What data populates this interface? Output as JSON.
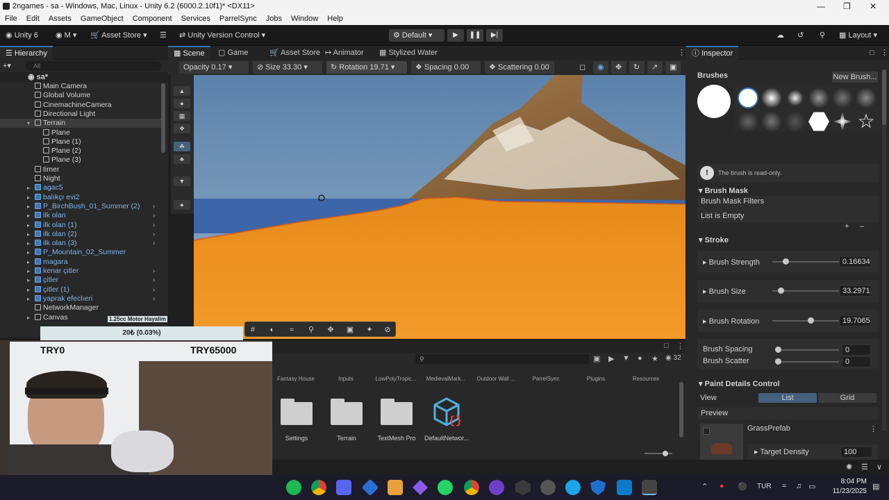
{
  "window": {
    "title": "2ngames - sa - Windows, Mac, Linux - Unity 6.2 (6000.2.10f1)* <DX11>"
  },
  "menu": [
    "File",
    "Edit",
    "Assets",
    "GameObject",
    "Component",
    "Services",
    "ParrelSync",
    "Jobs",
    "Window",
    "Help"
  ],
  "toolbar": {
    "account": "Unity 6",
    "m_label": "M",
    "asset_store": "Asset Store",
    "version_control": "Unity Version Control",
    "layout_default": "Default",
    "layout": "Layout"
  },
  "hierarchy": {
    "title": "Hierarchy",
    "search_placeholder": "All",
    "scene": "sa*",
    "items": [
      {
        "name": "Main Camera",
        "prefab": false,
        "indent": 1
      },
      {
        "name": "Global Volume",
        "prefab": false,
        "indent": 1
      },
      {
        "name": "CinemachineCamera",
        "prefab": false,
        "indent": 1
      },
      {
        "name": "Directional Light",
        "prefab": false,
        "indent": 1
      },
      {
        "name": "Terrain",
        "prefab": false,
        "indent": 1
      },
      {
        "name": "Plane",
        "prefab": false,
        "indent": 2
      },
      {
        "name": "Plane (1)",
        "prefab": false,
        "indent": 2
      },
      {
        "name": "Plane (2)",
        "prefab": false,
        "indent": 2
      },
      {
        "name": "Plane (3)",
        "prefab": false,
        "indent": 2
      },
      {
        "name": "timer",
        "prefab": false,
        "indent": 1
      },
      {
        "name": "Night",
        "prefab": false,
        "indent": 1
      },
      {
        "name": "agac5",
        "prefab": true,
        "indent": 1
      },
      {
        "name": "balıkçı evi2",
        "prefab": true,
        "indent": 1
      },
      {
        "name": "P_BirchBush_01_Summer (2)",
        "prefab": true,
        "indent": 1
      },
      {
        "name": "ilk olan",
        "prefab": true,
        "indent": 1
      },
      {
        "name": "ilk olan (1)",
        "prefab": true,
        "indent": 1
      },
      {
        "name": "ilk olan (2)",
        "prefab": true,
        "indent": 1
      },
      {
        "name": "ilk olan (3)",
        "prefab": true,
        "indent": 1
      },
      {
        "name": "P_Mountain_02_Summer",
        "prefab": true,
        "indent": 1
      },
      {
        "name": "magara",
        "prefab": true,
        "indent": 1
      },
      {
        "name": "kenar çitler",
        "prefab": true,
        "indent": 1
      },
      {
        "name": "çitler",
        "prefab": true,
        "indent": 1
      },
      {
        "name": "çitler (1)",
        "prefab": true,
        "indent": 1
      },
      {
        "name": "yaprak efeclıeri",
        "prefab": true,
        "indent": 1
      },
      {
        "name": "NetworkManager",
        "prefab": false,
        "indent": 1
      },
      {
        "name": "Canvas",
        "prefab": false,
        "indent": 1
      }
    ]
  },
  "scene_tabs": [
    "Scene",
    "Game",
    "Asset Store",
    "Animator",
    "Stylized Water"
  ],
  "scene_toolbar": {
    "opacity": "Opacity 0.17",
    "size": "Size 33.30",
    "rotation": "Rotation 19.71",
    "spacing": "Spacing 0.00",
    "scattering": "Scattering 0.00"
  },
  "project": {
    "count": "32",
    "top_folders": [
      "Fantasy House",
      "Inputs",
      "LowPolyTropic...",
      "MedievalMark...",
      "Outdoor Wall ...",
      "ParrelSync",
      "Plugins",
      "Resources"
    ],
    "items": [
      "Settings",
      "Terrain",
      "TextMesh Pro",
      "DefaultNetwor..."
    ]
  },
  "inspector": {
    "title": "Inspector",
    "brushes_label": "Brushes",
    "new_brush": "New Brush...",
    "readonly_msg": "The brush is read-only.",
    "brush_mask": "Brush Mask",
    "brush_mask_filters": "Brush Mask Filters",
    "list_empty": "List is Empty",
    "stroke": "Stroke",
    "brush_strength_label": "Brush Strength",
    "brush_strength_value": "0.16634",
    "brush_strength": 0.166,
    "brush_size_label": "Brush Size",
    "brush_size_value": "33.2971",
    "brush_size": 0.09,
    "brush_rotation_label": "Brush Rotation",
    "brush_rotation_value": "19.7065",
    "brush_rotation": 0.55,
    "brush_spacing_label": "Brush Spacing",
    "brush_spacing_value": "0",
    "brush_scatter_label": "Brush Scatter",
    "brush_scatter_value": "0",
    "paint_details": "Paint Details Control",
    "view": "View",
    "list": "List",
    "grid": "Grid",
    "preview": "Preview",
    "grass_prefab": "GrassPrefab",
    "target_density": "Target Density",
    "target_density_value": "100"
  },
  "webcam": {
    "overlay_top": "1.25cc Motor Hayalim",
    "overlay_bar": "20₺ (0.03%)",
    "try0": "TRY0",
    "try_goal": "TRY65000"
  },
  "taskbar": {
    "lang": "TUR",
    "time": "8:04 PM",
    "date": "11/23/2025"
  },
  "colors": {
    "accent": "#3a79bb",
    "prefab_blue": "#7fb4ee",
    "terrain_orange": "#e8891e"
  }
}
